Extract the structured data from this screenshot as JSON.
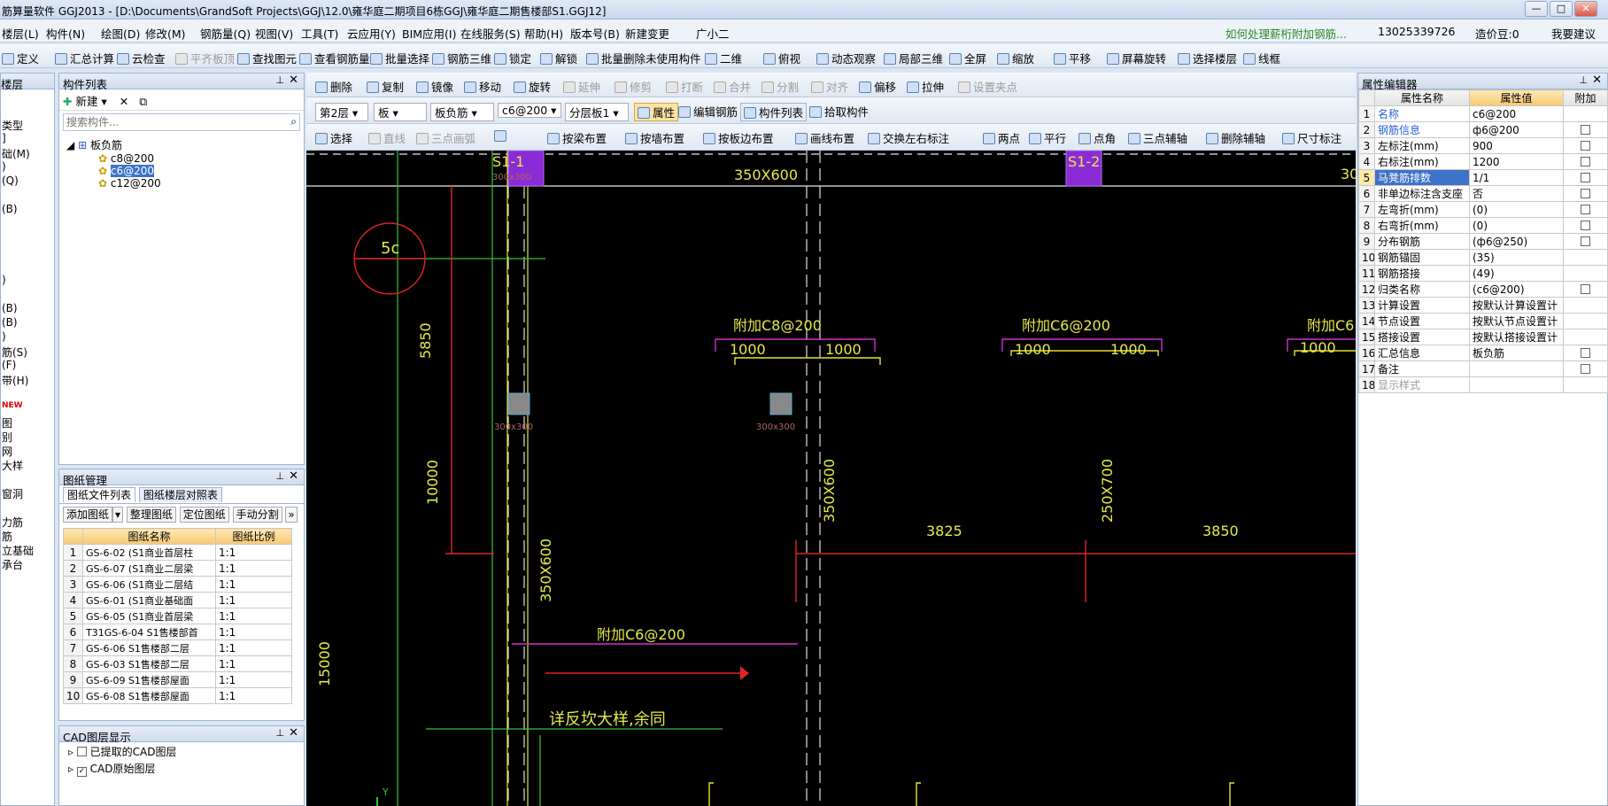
{
  "title": "筋算量软件 GGJ2013 - [D:\\Documents\\GrandSoft Projects\\GGJ\\12.0\\雍华庭二期项目6栋GGJ\\雍华庭二期售楼部S1.GGJ12]",
  "window": {
    "min": "—",
    "restore": "□",
    "close": "✕"
  },
  "menu": [
    "楼层(L)",
    "构件(N)",
    "绘图(D)",
    "修改(M)",
    "钢筋量(Q)",
    "视图(V)",
    "工具(T)",
    "云应用(Y)",
    "BIM应用(I)",
    "在线服务(S)",
    "帮助(H)",
    "版本号(B)",
    "新建变更",
    "广小二"
  ],
  "menu_right": {
    "hint": "如何处理薪桁附加钢筋...",
    "phone": "13025339726",
    "price": "造价豆:0",
    "want": "我要建议"
  },
  "toolbar1": [
    "定义",
    "汇总计算",
    "云检查",
    "平齐板顶",
    "查找图元",
    "查看钢筋量",
    "批量选择",
    "钢筋三维",
    "锁定",
    "解锁",
    "批量删除未使用构件",
    "二维",
    "俯视",
    "动态观察",
    "局部三维",
    "全屏",
    "缩放",
    "平移",
    "屏幕旋转",
    "选择楼层",
    "线框"
  ],
  "toolbar_edit": [
    "删除",
    "复制",
    "镜像",
    "移动",
    "旋转",
    "延伸",
    "修剪",
    "打断",
    "合并",
    "分割",
    "对齐",
    "偏移",
    "拉伸",
    "设置夹点"
  ],
  "toolbar_prop": {
    "floor": "第2层",
    "type": "板",
    "sub": "板负筋",
    "comp": "c6@200",
    "layer": "分层板1",
    "prop": "属性",
    "edit_rebar": "编辑钢筋",
    "comp_list": "构件列表",
    "pick": "拾取构件"
  },
  "toolbar_draw": [
    "选择",
    "直线",
    "三点画弧",
    "",
    "按梁布置",
    "按墙布置",
    "按板边布置",
    "画线布置",
    "交换左右标注",
    "两点",
    "平行",
    "点角",
    "三点辅轴",
    "删除辅轴",
    "尺寸标注"
  ],
  "left_nav": [
    "楼层",
    "",
    "",
    "类型",
    "]",
    "础(M)",
    ")",
    "(Q)",
    "",
    "(B)",
    "",
    "",
    "",
    "",
    ")",
    "",
    "(B)",
    "(B)",
    ")",
    "筋(S)",
    "(F)",
    "带(H)",
    "",
    "NEW",
    "图",
    "别",
    "网",
    "大样",
    "",
    "窗洞",
    "",
    "力筋",
    "筋",
    "立基础",
    "承台"
  ],
  "comp_panel": {
    "title": "构件列表",
    "new": "新建",
    "search_placeholder": "搜索构件...",
    "root": "板负筋",
    "items": [
      "c8@200",
      "c6@200",
      "c12@200"
    ]
  },
  "drawing_panel": {
    "title": "图纸管理",
    "tabs": [
      "图纸文件列表",
      "图纸楼层对照表"
    ],
    "buttons": [
      "添加图纸",
      "整理图纸",
      "定位图纸",
      "手动分割"
    ],
    "headers": [
      "图纸名称",
      "图纸比例"
    ],
    "rows": [
      [
        "1",
        "GS-6-02 (S1商业首层柱",
        "1:1"
      ],
      [
        "2",
        "GS-6-07 (S1商业二层梁",
        "1:1"
      ],
      [
        "3",
        "GS-6-06 (S1商业二层结",
        "1:1"
      ],
      [
        "4",
        "GS-6-01 (S1商业基础面",
        "1:1"
      ],
      [
        "5",
        "GS-6-05 (S1商业首层梁",
        "1:1"
      ],
      [
        "6",
        "T31GS-6-04 S1售楼部首",
        "1:1"
      ],
      [
        "7",
        "GS-6-06 S1售楼部二层",
        "1:1"
      ],
      [
        "8",
        "GS-6-03 S1售楼部二层",
        "1:1"
      ],
      [
        "9",
        "GS-6-09 S1售楼部屋面",
        "1:1"
      ],
      [
        "10",
        "GS-6-08 S1售楼部屋面",
        "1:1"
      ]
    ]
  },
  "cad_panel": {
    "title": "CAD图层显示",
    "items": [
      "已提取的CAD图层",
      "CAD原始图层"
    ]
  },
  "prop_panel": {
    "title": "属性编辑器",
    "headers": [
      "属性名称",
      "属性值",
      "附加"
    ],
    "rows": [
      [
        "1",
        "名称",
        "c6@200"
      ],
      [
        "2",
        "钢筋信息",
        "ф6@200"
      ],
      [
        "3",
        "左标注(mm)",
        "900"
      ],
      [
        "4",
        "右标注(mm)",
        "1200"
      ],
      [
        "5",
        "马凳筋排数",
        "1/1"
      ],
      [
        "6",
        "非单边标注含支座",
        "否"
      ],
      [
        "7",
        "左弯折(mm)",
        "(0)"
      ],
      [
        "8",
        "右弯折(mm)",
        "(0)"
      ],
      [
        "9",
        "分布钢筋",
        "(ф6@250)"
      ],
      [
        "10",
        "钢筋锚固",
        "(35)"
      ],
      [
        "11",
        "钢筋搭接",
        "(49)"
      ],
      [
        "12",
        "归类名称",
        "(c6@200)"
      ],
      [
        "13",
        "计算设置",
        "按默认计算设置计"
      ],
      [
        "14",
        "节点设置",
        "按默认节点设置计"
      ],
      [
        "15",
        "搭接设置",
        "按默认搭接设置计"
      ],
      [
        "16",
        "汇总信息",
        "板负筋"
      ],
      [
        "17",
        "备注",
        ""
      ],
      [
        "18",
        "显示样式",
        ""
      ]
    ]
  },
  "cad": {
    "s11": "S1-1",
    "s12": "S1-2",
    "beam_top": "350X600",
    "col_lbl": "300x300",
    "circle": "5c",
    "dim_5850": "5850",
    "dim_10000": "10000",
    "dim_15000": "15000",
    "v350": "350X600",
    "v350b": "350X600",
    "v250": "250X700",
    "d3825": "3825",
    "d3850": "3850",
    "fj1": "附加C8@200",
    "fj2": "附加C6@200",
    "fj3": "附加C6",
    "fj4": "附加C6@200",
    "n1000a": "1000",
    "n1000b": "1000",
    "n1000c": "1000",
    "n1000d": "1000",
    "n1000e": "1000",
    "note": "详反坎大样,余同",
    "y": "Y",
    "thirty": "30",
    "col_small": "300x300"
  }
}
